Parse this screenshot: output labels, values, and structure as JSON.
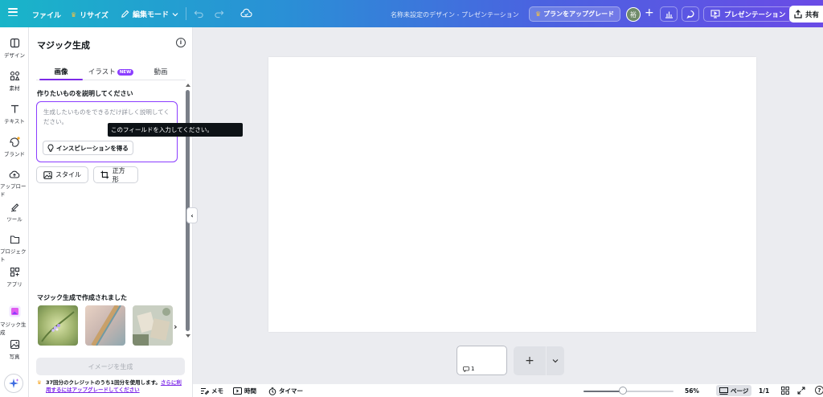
{
  "topbar": {
    "file": "ファイル",
    "resize": "リサイズ",
    "edit_mode": "編集モード",
    "doc_title": "名称未設定のデザイン - プレゼンテーション",
    "upgrade": "プランをアップグレード",
    "avatar_initial": "裕",
    "present": "プレゼンテーション",
    "share": "共有"
  },
  "rail": {
    "items": [
      {
        "label": "デザイン",
        "icon": "layout-icon"
      },
      {
        "label": "素材",
        "icon": "shapes-icon"
      },
      {
        "label": "テキスト",
        "icon": "text-icon"
      },
      {
        "label": "ブランド",
        "icon": "brand-icon"
      },
      {
        "label": "アップロード",
        "icon": "cloud-upload-icon"
      },
      {
        "label": "ツール",
        "icon": "draw-icon"
      },
      {
        "label": "プロジェクト",
        "icon": "folder-icon"
      },
      {
        "label": "アプリ",
        "icon": "apps-icon"
      },
      {
        "label": "マジック生成",
        "icon": "magic-media-icon"
      },
      {
        "label": "写真",
        "icon": "photo-icon"
      }
    ]
  },
  "panel": {
    "title": "マジック生成",
    "tabs": [
      {
        "label": "画像"
      },
      {
        "label": "イラスト",
        "badge": "NEW"
      },
      {
        "label": "動画"
      }
    ],
    "prompt_label": "作りたいものを説明してください",
    "prompt_placeholder": "生成したいものをできるだけ詳しく説明してください。",
    "inspire_button": "インスピレーションを得る",
    "style_button": "スタイル",
    "aspect_button": "正方形",
    "made_label": "マジック生成で作成されました",
    "generate_button": "イメージを生成",
    "credits_text": "37回分のクレジットのうち1回分を使用します。",
    "credits_link": "さらに利用するにはアップグレードしてください"
  },
  "tooltip": "このフィールドを入力してください。",
  "pages": {
    "thumb_number": "1"
  },
  "bottombar": {
    "notes": "メモ",
    "timing": "時間",
    "timer": "タイマー",
    "zoom": "56%",
    "zoom_fraction": 0.56,
    "pages_label": "ページ",
    "page_count": "1/1"
  },
  "colors": {
    "accent": "#8b3dff",
    "topbar_start": "#19b5c9",
    "topbar_end": "#6a4be6"
  }
}
